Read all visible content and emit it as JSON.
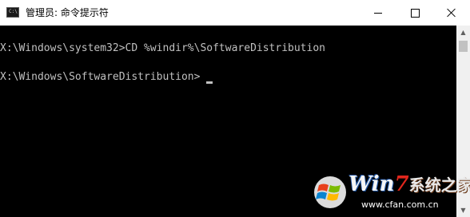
{
  "window": {
    "title": "管理员: 命令提示符",
    "icon": "cmd-icon",
    "controls": [
      "minimize-icon",
      "maximize-icon",
      "close-icon"
    ]
  },
  "console": {
    "lines": [
      "X:\\Windows\\system32>CD %windir%\\SoftwareDistribution",
      "X:\\Windows\\SoftwareDistribution>"
    ],
    "text_color": "#c0c0c0",
    "background": "#000000"
  },
  "watermark": {
    "brand_latin": "Win",
    "brand_number": "7",
    "brand_chinese": "系统之家",
    "url": "www.cfan.com.cn"
  }
}
